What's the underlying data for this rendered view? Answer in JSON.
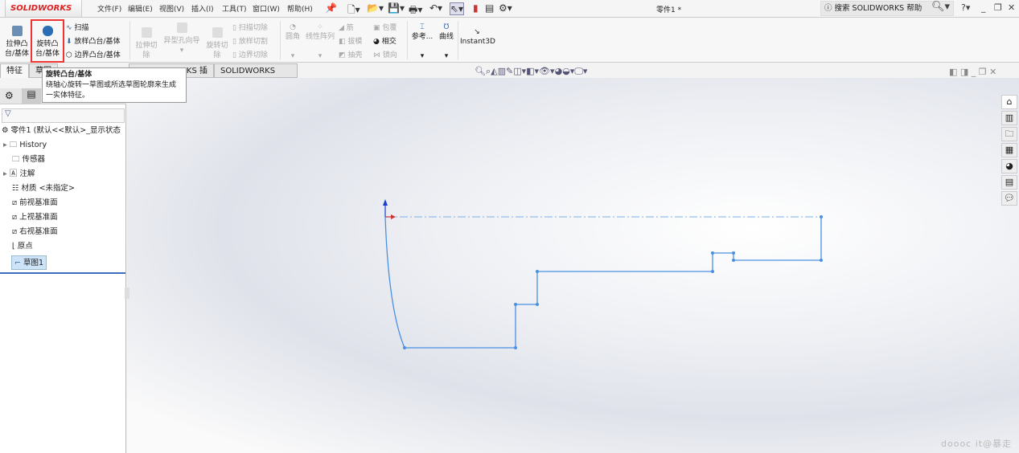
{
  "app": {
    "logo": "SOLIDWORKS",
    "doc_title": "零件1 *"
  },
  "menu": [
    "文件(F)",
    "编辑(E)",
    "视图(V)",
    "插入(I)",
    "工具(T)",
    "窗口(W)",
    "帮助(H)"
  ],
  "search": {
    "placeholder": "搜索 SOLIDWORKS 帮助"
  },
  "ribbon": {
    "extrude": "拉伸凸台/基体",
    "revolve": "旋转凸台/基体",
    "sweep": "扫描",
    "loft": "放样凸台/基体",
    "boundary": "边界凸台/基体",
    "extrude_cut": "拉伸切除",
    "hole_wizard": "异型孔向导",
    "revolve_cut": "旋转切除",
    "sweep_cut": "扫描切除",
    "loft_cut": "放样切割",
    "boundary_cut": "边界切除",
    "fillet": "圆角",
    "linear_pattern": "线性阵列",
    "rib": "筋",
    "draft": "拔模",
    "shell": "抽壳",
    "wrap": "包覆",
    "intersect": "相交",
    "mirror": "镜向",
    "reference": "参考...",
    "curves": "曲线",
    "instant3d": "Instant3D"
  },
  "tabs": [
    "特征",
    "草图",
    "SOLIDWORKS 插件",
    "SOLIDWORKS MBD"
  ],
  "tooltip": {
    "title": "旋转凸台/基体",
    "body": "绕轴心旋转一草图或所选草图轮廓来生成一实体特征。"
  },
  "tree": {
    "root": "零件1  (默认<<默认>_显示状态",
    "items": [
      "History",
      "传感器",
      "注解",
      "材质 <未指定>",
      "前视基准面",
      "上视基准面",
      "右视基准面",
      "原点",
      "草图1"
    ],
    "selected": "草图1"
  },
  "colors": {
    "sketch": "#4a90e2",
    "accent": "#d22"
  },
  "watermark": "doooc it@暴走"
}
